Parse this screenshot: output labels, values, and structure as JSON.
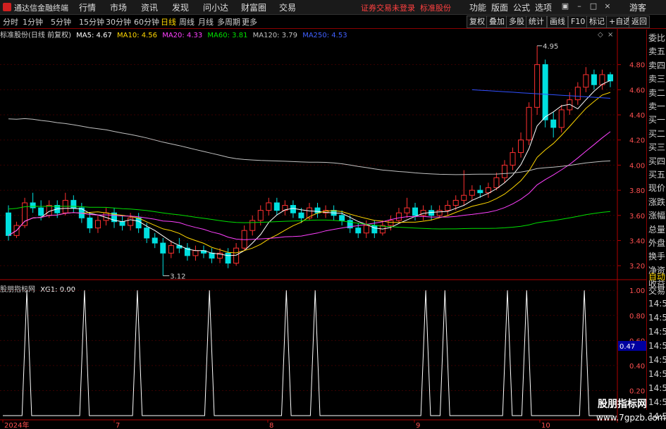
{
  "app": {
    "title": "通达信金融终端"
  },
  "menu": [
    "行情",
    "市场",
    "资讯",
    "发现",
    "问小达",
    "财富圈",
    "交易"
  ],
  "notice": {
    "login": "证券交易未登录",
    "stock": "标准股份"
  },
  "top_right": [
    "功能",
    "版面",
    "公式",
    "选项"
  ],
  "guest": "游客",
  "periods": [
    "分时",
    "1分钟",
    "5分钟",
    "15分钟",
    "30分钟",
    "60分钟",
    "日线",
    "周线",
    "月线",
    "多周期",
    "更多"
  ],
  "active_period": "日线",
  "tools": [
    "复权",
    "叠加",
    "多股",
    "统计",
    "画线",
    "F10",
    "标记",
    "+自选",
    "返回"
  ],
  "ma_legend": {
    "title": "标准股份(日线 前复权)",
    "items": [
      {
        "text": "MA5: 4.67",
        "color": "#ffffff"
      },
      {
        "text": "MA10: 4.56",
        "color": "#ffd700"
      },
      {
        "text": "MA20: 4.33",
        "color": "#ff40ff"
      },
      {
        "text": "MA60: 3.81",
        "color": "#00e000"
      },
      {
        "text": "MA120: 3.79",
        "color": "#c0c0c0"
      },
      {
        "text": "MA250: 4.53",
        "color": "#4060ff"
      }
    ]
  },
  "sub_legend": {
    "title": "股朋指标网",
    "item": "XG1: 0.00"
  },
  "annotations": {
    "high": "4.95",
    "low": "3.12"
  },
  "chart_data": [
    {
      "type": "candlestick",
      "title": "标准股份(日线 前复权)",
      "y_ticks": [
        "4.80",
        "4.60",
        "4.40",
        "4.20",
        "4.00",
        "3.80",
        "3.60",
        "3.40",
        "3.20"
      ],
      "ylim": [
        3.1,
        5.0
      ],
      "x_labels": [
        "2024年",
        "7",
        "8",
        "9",
        "10"
      ],
      "high_label": "4.95",
      "low_label": "3.12",
      "candles": [
        [
          3.62,
          3.44,
          3.68,
          3.4
        ],
        [
          3.44,
          3.52,
          3.55,
          3.42
        ],
        [
          3.52,
          3.7,
          3.74,
          3.5
        ],
        [
          3.7,
          3.66,
          3.78,
          3.62
        ],
        [
          3.66,
          3.6,
          3.72,
          3.56
        ],
        [
          3.6,
          3.68,
          3.72,
          3.58
        ],
        [
          3.68,
          3.62,
          3.72,
          3.58
        ],
        [
          3.62,
          3.72,
          3.78,
          3.6
        ],
        [
          3.72,
          3.66,
          3.76,
          3.62
        ],
        [
          3.66,
          3.58,
          3.7,
          3.54
        ],
        [
          3.58,
          3.5,
          3.62,
          3.46
        ],
        [
          3.5,
          3.56,
          3.6,
          3.46
        ],
        [
          3.56,
          3.62,
          3.66,
          3.52
        ],
        [
          3.62,
          3.55,
          3.66,
          3.5
        ],
        [
          3.55,
          3.52,
          3.6,
          3.48
        ],
        [
          3.52,
          3.58,
          3.62,
          3.48
        ],
        [
          3.58,
          3.5,
          3.62,
          3.46
        ],
        [
          3.5,
          3.42,
          3.54,
          3.38
        ],
        [
          3.42,
          3.38,
          3.46,
          3.34
        ],
        [
          3.38,
          3.3,
          3.42,
          3.12
        ],
        [
          3.3,
          3.36,
          3.4,
          3.26
        ],
        [
          3.36,
          3.34,
          3.42,
          3.3
        ],
        [
          3.34,
          3.28,
          3.38,
          3.24
        ],
        [
          3.28,
          3.32,
          3.36,
          3.24
        ],
        [
          3.32,
          3.3,
          3.36,
          3.26
        ],
        [
          3.3,
          3.26,
          3.34,
          3.22
        ],
        [
          3.26,
          3.3,
          3.34,
          3.22
        ],
        [
          3.3,
          3.22,
          3.34,
          3.18
        ],
        [
          3.22,
          3.34,
          3.38,
          3.2
        ],
        [
          3.34,
          3.48,
          3.52,
          3.32
        ],
        [
          3.48,
          3.56,
          3.6,
          3.44
        ],
        [
          3.56,
          3.64,
          3.68,
          3.52
        ],
        [
          3.64,
          3.7,
          3.74,
          3.6
        ],
        [
          3.7,
          3.64,
          3.74,
          3.6
        ],
        [
          3.64,
          3.68,
          3.72,
          3.6
        ],
        [
          3.68,
          3.62,
          3.72,
          3.58
        ],
        [
          3.62,
          3.58,
          3.66,
          3.54
        ],
        [
          3.58,
          3.66,
          3.7,
          3.56
        ],
        [
          3.66,
          3.62,
          3.7,
          3.58
        ],
        [
          3.62,
          3.64,
          3.68,
          3.58
        ],
        [
          3.64,
          3.6,
          3.68,
          3.56
        ],
        [
          3.6,
          3.56,
          3.64,
          3.52
        ],
        [
          3.56,
          3.5,
          3.6,
          3.46
        ],
        [
          3.5,
          3.46,
          3.54,
          3.42
        ],
        [
          3.46,
          3.52,
          3.56,
          3.42
        ],
        [
          3.52,
          3.46,
          3.56,
          3.42
        ],
        [
          3.46,
          3.52,
          3.56,
          3.44
        ],
        [
          3.52,
          3.56,
          3.6,
          3.48
        ],
        [
          3.56,
          3.62,
          3.66,
          3.54
        ],
        [
          3.62,
          3.66,
          3.74,
          3.58
        ],
        [
          3.66,
          3.6,
          3.7,
          3.56
        ],
        [
          3.6,
          3.64,
          3.68,
          3.56
        ],
        [
          3.64,
          3.6,
          3.68,
          3.56
        ],
        [
          3.6,
          3.64,
          3.68,
          3.58
        ],
        [
          3.64,
          3.68,
          3.72,
          3.6
        ],
        [
          3.68,
          3.72,
          3.76,
          3.64
        ],
        [
          3.72,
          3.76,
          3.96,
          3.68
        ],
        [
          3.76,
          3.8,
          3.84,
          3.72
        ],
        [
          3.8,
          3.78,
          3.84,
          3.74
        ],
        [
          3.78,
          3.82,
          3.86,
          3.74
        ],
        [
          3.82,
          3.9,
          3.94,
          3.8
        ],
        [
          3.9,
          4.0,
          4.04,
          3.86
        ],
        [
          4.0,
          4.1,
          4.14,
          3.96
        ],
        [
          4.1,
          4.2,
          4.26,
          4.06
        ],
        [
          4.2,
          4.46,
          4.5,
          4.16
        ],
        [
          4.46,
          4.8,
          4.95,
          4.4
        ],
        [
          4.8,
          4.36,
          4.84,
          4.3
        ],
        [
          4.36,
          4.3,
          4.42,
          4.22
        ],
        [
          4.3,
          4.44,
          4.48,
          4.26
        ],
        [
          4.44,
          4.52,
          4.58,
          4.4
        ],
        [
          4.52,
          4.62,
          4.66,
          4.48
        ],
        [
          4.62,
          4.72,
          4.78,
          4.58
        ],
        [
          4.72,
          4.64,
          4.76,
          4.6
        ],
        [
          4.64,
          4.72,
          4.76,
          4.6
        ],
        [
          4.72,
          4.67,
          4.74,
          4.62
        ]
      ]
    },
    {
      "type": "line",
      "title": "股朋指标网",
      "series": [
        {
          "name": "XG1",
          "values": [
            0,
            0,
            0,
            0,
            0,
            1,
            0,
            0,
            0,
            0,
            0,
            0,
            0,
            0,
            0,
            0,
            0,
            1,
            0,
            0,
            0,
            0,
            0,
            0,
            0,
            0,
            0,
            0,
            1,
            0,
            0,
            0,
            0,
            0,
            0,
            0,
            0,
            0,
            0,
            0,
            0,
            0,
            0,
            1,
            0,
            0,
            0,
            0,
            0,
            0,
            0,
            0,
            0,
            0,
            0,
            0,
            0,
            0,
            0,
            1,
            0,
            0,
            0,
            0,
            0,
            1,
            0,
            0,
            0,
            0,
            0,
            0,
            0,
            0,
            0,
            0,
            0,
            0,
            0,
            0,
            0,
            0,
            0,
            0,
            0,
            0,
            0,
            0,
            1,
            0,
            0,
            0,
            1,
            0,
            0,
            0,
            0,
            0,
            0,
            0,
            0,
            0,
            0,
            0,
            0,
            1,
            0,
            0,
            0,
            1,
            0,
            0,
            0,
            0,
            0,
            0,
            0,
            0,
            0,
            0,
            0,
            1,
            0,
            0,
            0,
            0,
            0,
            0
          ]
        }
      ],
      "y_ticks": [
        "1.00",
        "0.80",
        "0.60",
        "0.40",
        "0.20"
      ],
      "ylim": [
        0,
        1.08
      ],
      "value_label": "0.47"
    }
  ],
  "sidebar": [
    "委比",
    "卖五",
    "卖四",
    "卖三",
    "卖二",
    "卖一",
    "买一",
    "买二",
    "买三",
    "买四",
    "买五",
    "现价",
    "涨跌",
    "涨幅",
    "总量",
    "外盘",
    "换手",
    "净资",
    "收益"
  ],
  "sidebar_lower": [
    "自动",
    "交易",
    "14:55",
    "14:56",
    "14:56",
    "14:56",
    "14:56",
    "14:56",
    "14:56",
    "14:56",
    "14:56"
  ],
  "watermark": {
    "title": "股朋指标网",
    "url": "www.7gpzb.com"
  },
  "colors": {
    "up": "#ff3030",
    "down": "#00e0e0",
    "grid": "#8b0000",
    "axis": "#b00000"
  }
}
